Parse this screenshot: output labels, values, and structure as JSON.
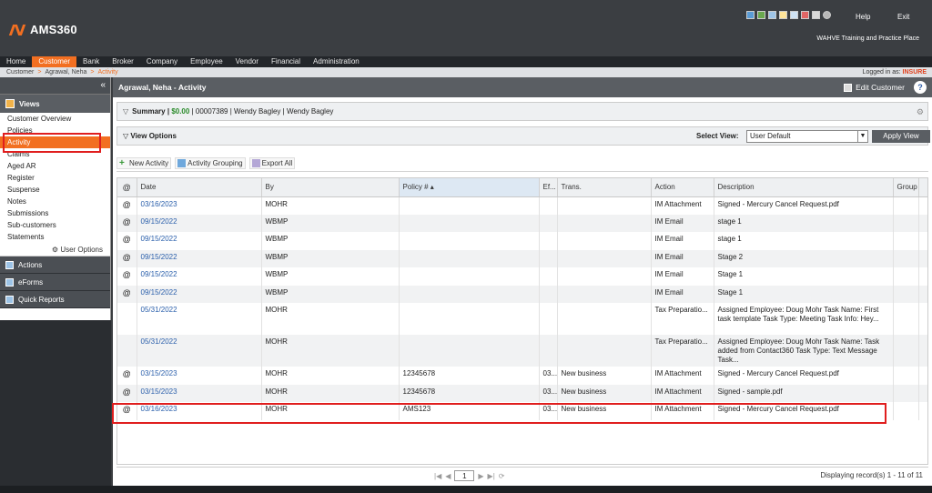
{
  "app": {
    "logo_text": "AMS360",
    "help": "Help",
    "exit": "Exit",
    "agency": "WAHVE Training and Practice Place"
  },
  "nav": [
    "Home",
    "Customer",
    "Bank",
    "Broker",
    "Company",
    "Employee",
    "Vendor",
    "Financial",
    "Administration"
  ],
  "breadcrumb": {
    "root": "Customer",
    "mid": "Agrawal, Neha",
    "current": "Activity",
    "logged_label": "Logged in as:",
    "logged_user": "INSURE"
  },
  "sidebar": {
    "views_label": "Views",
    "items": [
      "Customer Overview",
      "Policies",
      "Activity",
      "Claims",
      "Aged AR",
      "Register",
      "Suspense",
      "Notes",
      "Submissions",
      "Sub-customers",
      "Statements"
    ],
    "user_options": "User Options",
    "sections": [
      "Actions",
      "eForms",
      "Quick Reports"
    ]
  },
  "main": {
    "title": "Agrawal, Neha - Activity",
    "edit_customer": "Edit Customer",
    "summary_label": "Summary |",
    "summary_amount": "$0.00",
    "summary_rest": "| 00007389 | Wendy Bagley | Wendy Bagley",
    "view_options": "View Options",
    "select_view_label": "Select View:",
    "select_view_value": "User Default",
    "apply_view": "Apply View",
    "toolbar": {
      "new_activity": "New Activity",
      "activity_grouping": "Activity Grouping",
      "export_all": "Export All"
    }
  },
  "grid": {
    "headers": {
      "clip": "@",
      "date": "Date",
      "by": "By",
      "policy": "Policy # ▴",
      "ef": "Ef...",
      "trans": "Trans.",
      "action": "Action",
      "description": "Description",
      "group": "Group"
    },
    "rows": [
      {
        "clip": "@",
        "date": "03/16/2023",
        "by": "MOHR",
        "policy": "",
        "ef": "",
        "trans": "",
        "action": "IM Attachment",
        "description": "Signed - Mercury Cancel Request.pdf"
      },
      {
        "clip": "@",
        "date": "09/15/2022",
        "by": "WBMP",
        "policy": "",
        "ef": "",
        "trans": "",
        "action": "IM Email",
        "description": "stage 1"
      },
      {
        "clip": "@",
        "date": "09/15/2022",
        "by": "WBMP",
        "policy": "",
        "ef": "",
        "trans": "",
        "action": "IM Email",
        "description": "stage 1"
      },
      {
        "clip": "@",
        "date": "09/15/2022",
        "by": "WBMP",
        "policy": "",
        "ef": "",
        "trans": "",
        "action": "IM Email",
        "description": "Stage 2"
      },
      {
        "clip": "@",
        "date": "09/15/2022",
        "by": "WBMP",
        "policy": "",
        "ef": "",
        "trans": "",
        "action": "IM Email",
        "description": "Stage 1"
      },
      {
        "clip": "@",
        "date": "09/15/2022",
        "by": "WBMP",
        "policy": "",
        "ef": "",
        "trans": "",
        "action": "IM Email",
        "description": "Stage 1"
      },
      {
        "clip": "",
        "date": "05/31/2022",
        "by": "MOHR",
        "policy": "",
        "ef": "",
        "trans": "",
        "action": "Tax Preparatio...",
        "description": "Assigned Employee: Doug Mohr Task Name: First task template Task Type: Meeting Task Info: Hey..."
      },
      {
        "clip": "",
        "date": "05/31/2022",
        "by": "MOHR",
        "policy": "",
        "ef": "",
        "trans": "",
        "action": "Tax Preparatio...",
        "description": "Assigned Employee: Doug Mohr Task Name: Task added from Contact360 Task Type: Text Message Task..."
      },
      {
        "clip": "@",
        "date": "03/15/2023",
        "by": "MOHR",
        "policy": "12345678",
        "ef": "03...",
        "trans": "New business",
        "action": "IM Attachment",
        "description": "Signed - Mercury Cancel Request.pdf"
      },
      {
        "clip": "@",
        "date": "03/15/2023",
        "by": "MOHR",
        "policy": "12345678",
        "ef": "03...",
        "trans": "New business",
        "action": "IM Attachment",
        "description": "Signed - sample.pdf"
      },
      {
        "clip": "@",
        "date": "03/16/2023",
        "by": "MOHR",
        "policy": "AMS123",
        "ef": "03...",
        "trans": "New business",
        "action": "IM Attachment",
        "description": "Signed - Mercury Cancel Request.pdf"
      }
    ]
  },
  "pager": {
    "page": "1",
    "info": "Displaying record(s) 1 - 11 of 11"
  }
}
